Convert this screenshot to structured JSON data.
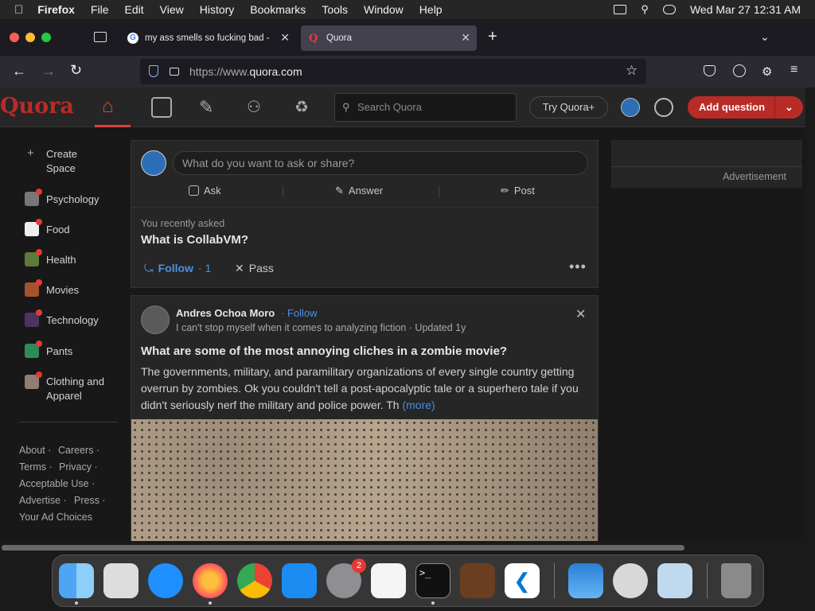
{
  "menubar": {
    "app": "Firefox",
    "items": [
      "File",
      "Edit",
      "View",
      "History",
      "Bookmarks",
      "Tools",
      "Window",
      "Help"
    ],
    "datetime": "Wed Mar 27  12:31 AM"
  },
  "tabs": [
    {
      "title": "my ass smells so fucking bad - ",
      "active": false
    },
    {
      "title": "Quora",
      "active": true
    }
  ],
  "url": {
    "prefix": "https://www.",
    "domain": "quora.com"
  },
  "quora": {
    "logo": "Quora",
    "search_placeholder": "Search Quora",
    "try_plus": "Try Quora+",
    "add_question": "Add question"
  },
  "sidebar": {
    "create_space": "Create Space",
    "spaces": [
      "Psychology",
      "Food",
      "Health",
      "Movies",
      "Technology",
      "Pants",
      "Clothing and Apparel"
    ],
    "footer": [
      "About ·",
      "Careers ·",
      "Terms ·",
      "Privacy ·",
      "Acceptable Use ·",
      "Advertise ·",
      "Press ·",
      "Your Ad Choices"
    ]
  },
  "ask_box": {
    "placeholder": "What do you want to ask or share?",
    "ask": "Ask",
    "answer": "Answer",
    "post": "Post"
  },
  "recent": {
    "label": "You recently asked",
    "question": "What is CollabVM?",
    "follow": "Follow",
    "follow_count": "· 1",
    "pass": "Pass"
  },
  "post": {
    "author": "Andres Ochoa Moro",
    "follow": "· Follow",
    "meta": "I can't stop myself when it comes to analyzing fiction · Updated 1y",
    "question": "What are some of the most annoying cliches in a zombie movie?",
    "body": "The governments, military, and paramilitary organizations of every single country getting overrun by zombies. Ok you couldn't tell a post-apocalyptic tale or a superhero tale if you didn't seriously nerf the military and police power. Th",
    "more": "(more)"
  },
  "ad": {
    "label": "Advertisement"
  },
  "dock": {
    "badge": "2"
  }
}
